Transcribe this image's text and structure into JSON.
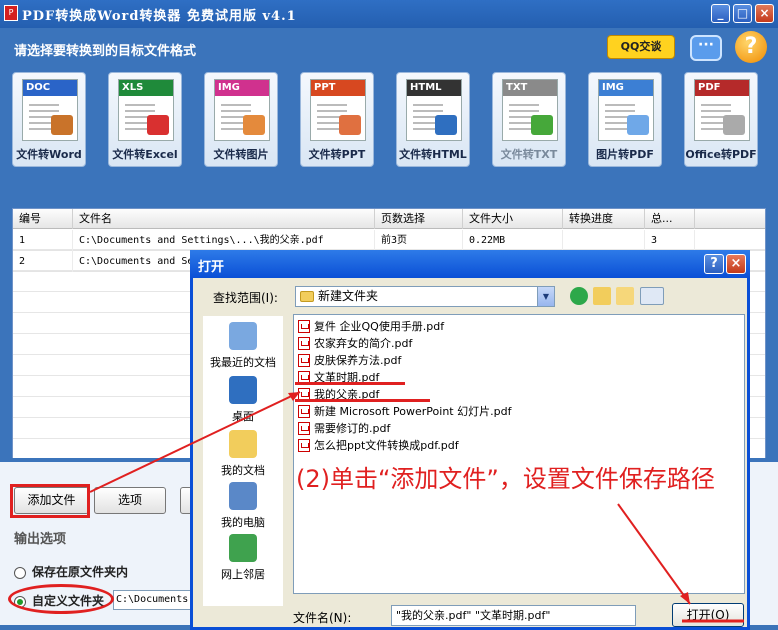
{
  "window": {
    "title": "PDF转换成Word转换器 免费试用版 v4.1",
    "subtitle": "请选择要转换到的目标文件格式",
    "qq_label": "QQ交谈",
    "help_label": "?",
    "min_label": "_",
    "max_label": "□",
    "close_label": "×"
  },
  "tools": [
    {
      "band": "DOC",
      "label": "文件转Word",
      "color": "#2a64c8",
      "pic": "#c9732a"
    },
    {
      "band": "XLS",
      "label": "文件转Excel",
      "color": "#1f8a3a",
      "pic": "#d93030"
    },
    {
      "band": "IMG",
      "label": "文件转图片",
      "color": "#d0318e",
      "pic": "#e48a3c"
    },
    {
      "band": "PPT",
      "label": "文件转PPT",
      "color": "#d74820",
      "pic": "#e07040"
    },
    {
      "band": "HTML",
      "label": "文件转HTML",
      "color": "#333333",
      "pic": "#2f6fc0"
    },
    {
      "band": "TXT",
      "label": "文件转TXT",
      "color": "#8a8a8a",
      "pic": "#46a83a"
    },
    {
      "band": "IMG",
      "label": "图片转PDF",
      "color": "#3c7fd4",
      "pic": "#6fa8e8"
    },
    {
      "band": "PDF",
      "label": "Office转PDF",
      "color": "#b52a2a",
      "pic": "#aaaaaa"
    }
  ],
  "grid": {
    "columns": [
      "编号",
      "文件名",
      "页数选择",
      "文件大小",
      "转换进度",
      "总..."
    ],
    "rows": [
      {
        "no": "1",
        "name": "C:\\Documents and Settings\\...\\我的父亲.pdf",
        "pages": "前3页",
        "size": "0.22MB",
        "progress": "",
        "total": "3"
      },
      {
        "no": "2",
        "name": "C:\\Documents and Se",
        "pages": "",
        "size": "",
        "progress": "",
        "total": ""
      }
    ]
  },
  "bottom": {
    "add_file": "添加文件",
    "options": "选项",
    "output_title": "输出选项",
    "radio_keep": "保存在原文件夹内",
    "radio_custom": "自定义文件夹",
    "custom_path": "C:\\Documents"
  },
  "dialog": {
    "title": "打开",
    "help": "?",
    "close": "×",
    "lookin_label": "查找范围(I):",
    "lookin_value": "新建文件夹",
    "places": [
      "我最近的文档",
      "桌面",
      "我的文档",
      "我的电脑",
      "网上邻居"
    ],
    "files": [
      "复件 企业QQ使用手册.pdf",
      "农家弃女的简介.pdf",
      "皮肤保养方法.pdf",
      "文革时期.pdf",
      "我的父亲.pdf",
      "新建 Microsoft PowerPoint 幻灯片.pdf",
      "需要修订的.pdf",
      "怎么把ppt文件转换成pdf.pdf"
    ],
    "filename_label": "文件名(N):",
    "filename_value": "\"我的父亲.pdf\" \"文革时期.pdf\"",
    "open_button": "打开(O)"
  },
  "annotation": {
    "text": "(2)单击“添加文件”，设置文件保存路径",
    "color": "#e02020"
  }
}
